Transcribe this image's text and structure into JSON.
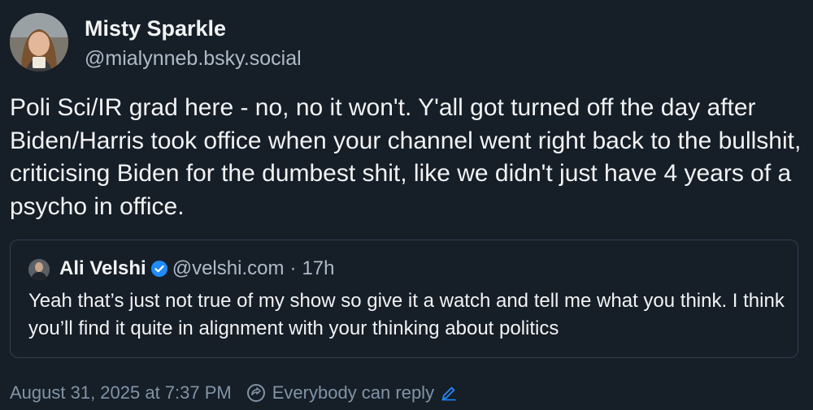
{
  "post": {
    "author": {
      "display_name": "Misty Sparkle",
      "handle": "@mialynneb.bsky.social"
    },
    "text": "Poli Sci/IR grad here - no, no it won't. Y'all got turned off the day after Biden/Harris took office when your channel went right back to the bullshit, criticising Biden for the dumbest shit, like we didn't just have 4 years of a psycho in office.",
    "quote": {
      "author_name": "Ali Velshi",
      "verified": true,
      "handle": "@velshi.com",
      "separator": "·",
      "time_ago": "17h",
      "text": "Yeah that’s just not true of my show so give it a watch and tell me what you think. I think you’ll find it quite in alignment with your thinking about politics"
    },
    "timestamp": "August 31, 2025 at 7:37 PM",
    "reply_setting": "Everybody can reply"
  },
  "icons": {
    "verified": "verified-check-icon",
    "reply_setting": "reply-settings-icon",
    "edit": "pencil-icon"
  },
  "colors": {
    "background": "#161e27",
    "text": "#f1f3f5",
    "muted": "#aebbc9",
    "footer": "#8194a7",
    "accent": "#208bfe",
    "quote_border": "#2e4052"
  }
}
